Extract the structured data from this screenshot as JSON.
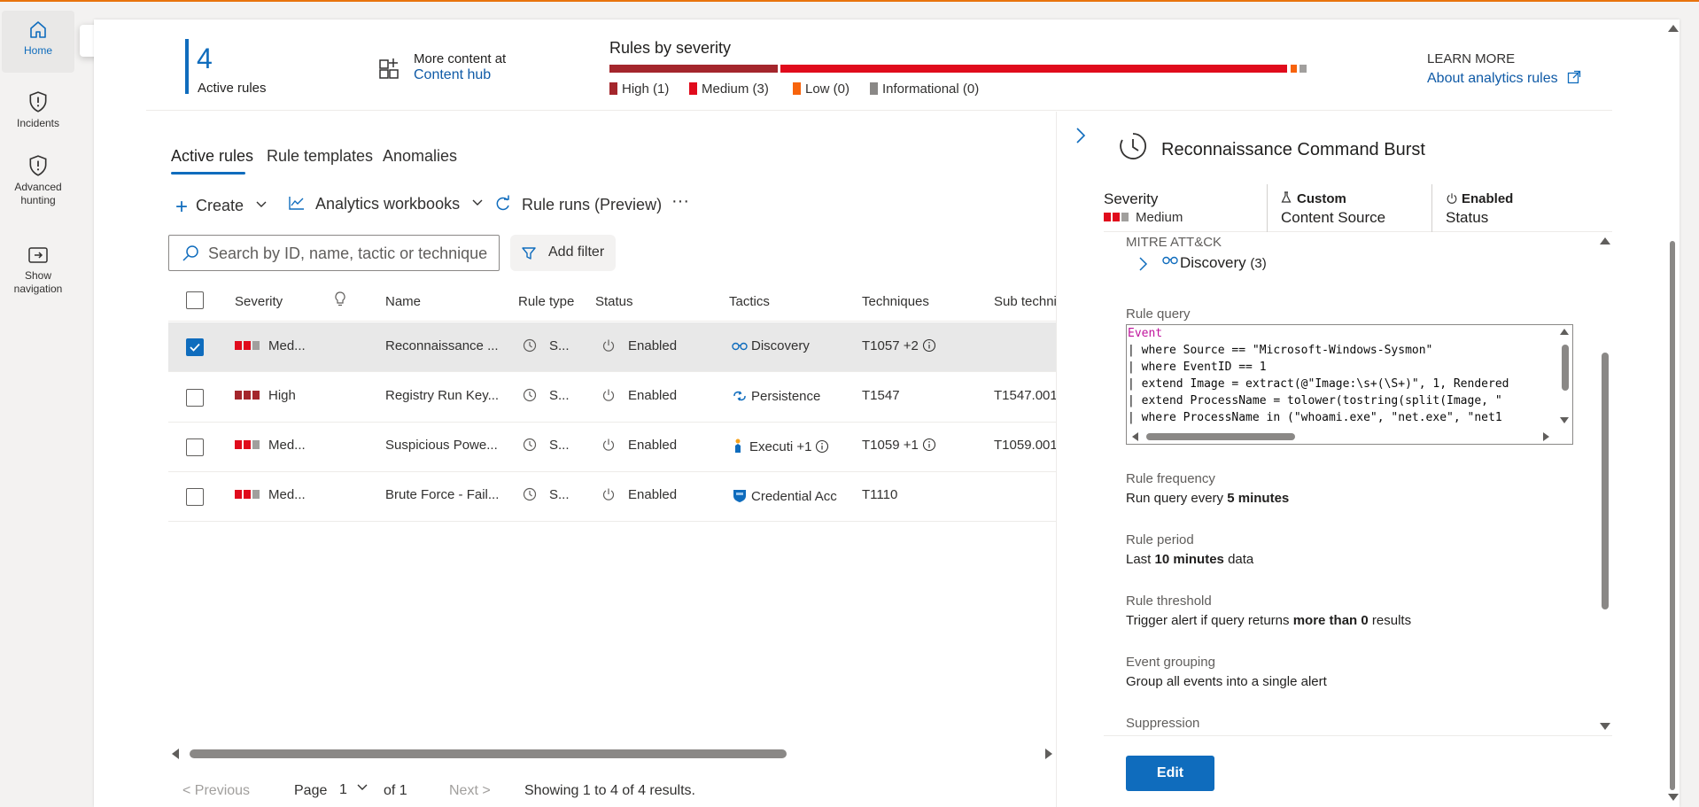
{
  "nav": {
    "items": [
      {
        "label": "Home",
        "icon": "home-icon"
      },
      {
        "label": "Incidents",
        "icon": "shield-icon"
      },
      {
        "label": "Advanced hunting",
        "icon": "shield-icon"
      },
      {
        "label": "Show navigation",
        "icon": "show-navigation-icon"
      }
    ],
    "tooltip": "Home"
  },
  "header": {
    "active_rules_count": "4",
    "active_rules_label": "Active rules",
    "content_line1": "More content at",
    "content_link": "Content hub",
    "severity_title": "Rules by severity",
    "severity_legend": [
      {
        "label": "High (1)",
        "color": "#a4262c",
        "count": 1
      },
      {
        "label": "Medium (3)",
        "color": "#e00b1c",
        "count": 3
      },
      {
        "label": "Low (0)",
        "color": "#f7630c",
        "count": 0
      },
      {
        "label": "Informational (0)",
        "color": "#8a8886",
        "count": 0
      }
    ],
    "learn_more": "LEARN MORE",
    "learn_more_link": "About analytics rules"
  },
  "tabs": [
    "Active rules",
    "Rule templates",
    "Anomalies"
  ],
  "toolbar": {
    "create": "Create",
    "workbooks": "Analytics workbooks",
    "rule_runs": "Rule runs (Preview)",
    "more": "···"
  },
  "search": {
    "placeholder": "Search by ID, name, tactic or technique"
  },
  "filter_label": "Add filter",
  "table": {
    "columns": [
      "Severity",
      "Name",
      "Rule type",
      "Status",
      "Tactics",
      "Techniques",
      "Sub techni"
    ],
    "rows": [
      {
        "severity": "Med...",
        "level": "medium",
        "name": "Reconnaissance ...",
        "type": "S...",
        "status": "Enabled",
        "tactic": "Discovery",
        "tactic_extra": "",
        "technique": "T1057 +2",
        "sub": "",
        "selected": true
      },
      {
        "severity": "High",
        "level": "high",
        "name": "Registry Run Key...",
        "type": "S...",
        "status": "Enabled",
        "tactic": "Persistence",
        "tactic_extra": "",
        "technique": "T1547",
        "sub": "T1547.001",
        "selected": false
      },
      {
        "severity": "Med...",
        "level": "medium",
        "name": "Suspicious Powe...",
        "type": "S...",
        "status": "Enabled",
        "tactic": "Executi",
        "tactic_extra": "+1",
        "technique": "T1059 +1",
        "sub": "T1059.001",
        "selected": false
      },
      {
        "severity": "Med...",
        "level": "medium",
        "name": "Brute Force - Fail...",
        "type": "S...",
        "status": "Enabled",
        "tactic": "Credential Acc",
        "tactic_extra": "",
        "technique": "T1110",
        "sub": "",
        "selected": false
      }
    ]
  },
  "pager": {
    "previous": "< Previous",
    "page_label": "Page",
    "page": "1",
    "of": "of 1",
    "next": "Next >",
    "showing": "Showing 1 to 4 of 4 results."
  },
  "panel": {
    "title": "Reconnaissance Command Burst",
    "severity_label": "Severity",
    "severity_value": "Medium",
    "source_value": "Custom",
    "source_label": "Content Source",
    "status_value": "Enabled",
    "status_label": "Status",
    "mitre_label": "MITRE ATT&CK",
    "mitre_tactic": "Discovery",
    "mitre_count": "(3)",
    "query_label": "Rule query",
    "query_lines": [
      "Event",
      "| where Source == \"Microsoft-Windows-Sysmon\"",
      "| where EventID == 1",
      "| extend Image = extract(@\"Image:\\s+(\\S+)\", 1, Rendered",
      "| extend ProcessName = tolower(tostring(split(Image, \"",
      "| where ProcessName in (\"whoami.exe\", \"net.exe\", \"net1"
    ],
    "frequency_label": "Rule frequency",
    "frequency_prefix": "Run query every",
    "frequency_value": "5 minutes",
    "period_label": "Rule period",
    "period_prefix": "Last",
    "period_value": "10 minutes",
    "period_suffix": "data",
    "threshold_label": "Rule threshold",
    "threshold_prefix": "Trigger alert if query returns",
    "threshold_value": "more than 0",
    "threshold_suffix": "results",
    "grouping_label": "Event grouping",
    "grouping_value": "Group all events into a single alert",
    "suppression_label": "Suppression",
    "edit": "Edit"
  }
}
